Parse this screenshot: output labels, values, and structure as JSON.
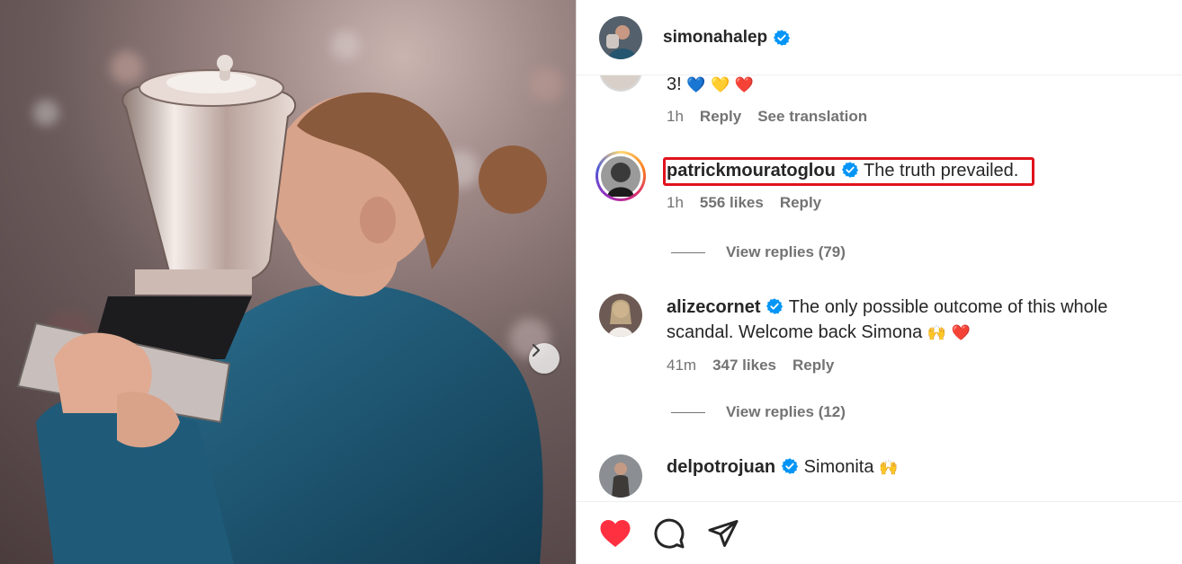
{
  "post": {
    "author": "simonahalep",
    "verified": true
  },
  "comments": [
    {
      "id": "c0",
      "text": "3!",
      "emojis": [
        "💙",
        "💛",
        "❤️"
      ],
      "time": "1h",
      "reply_label": "Reply",
      "translate_label": "See translation"
    },
    {
      "id": "c1",
      "username": "patrickmouratoglou",
      "verified": true,
      "text": "The truth prevailed.",
      "time": "1h",
      "likes": "556 likes",
      "reply_label": "Reply",
      "view_replies": "View replies (79)",
      "highlighted": true,
      "highlight_color": "#e0121c"
    },
    {
      "id": "c2",
      "username": "alizecornet",
      "verified": true,
      "text_line1": "The only possible outcome of this whole",
      "text_line2": "scandal. Welcome back Simona",
      "emojis": [
        "🙌",
        "❤️"
      ],
      "time": "41m",
      "likes": "347 likes",
      "reply_label": "Reply",
      "view_replies": "View replies (12)"
    },
    {
      "id": "c3",
      "username": "delpotrojuan",
      "verified": true,
      "text": "Simonita",
      "emojis": [
        "🙌"
      ]
    }
  ],
  "actions": {
    "like_icon": "heart-filled-icon",
    "comment_icon": "comment-icon",
    "share_icon": "share-icon",
    "like_color": "#ff3040"
  },
  "colors": {
    "verified": "#0095f6",
    "text": "#262626",
    "secondary": "#737373"
  }
}
